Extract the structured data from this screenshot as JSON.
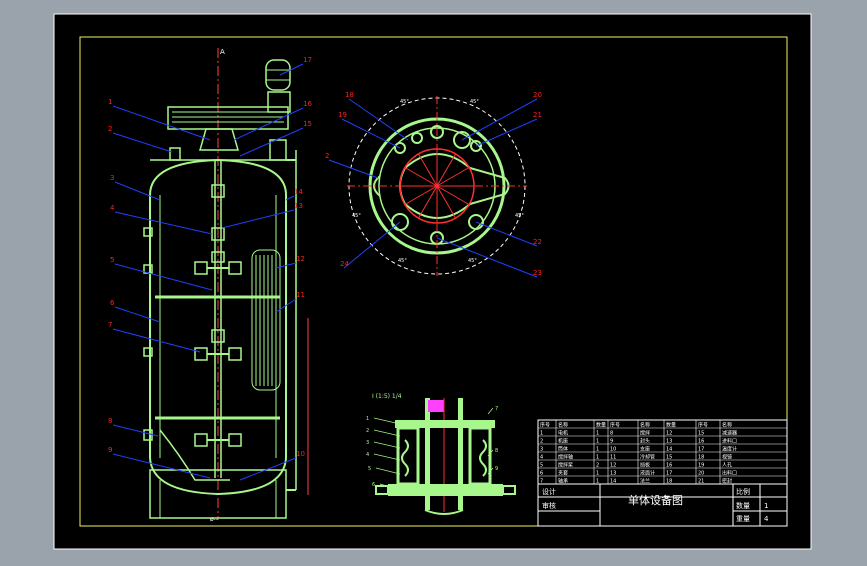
{
  "colors": {
    "canvas": "#9aa3ac",
    "paper": "#000000",
    "frame": "#f0f060",
    "border": "#ffffff",
    "equipment": "#a8f78c",
    "leader": "#2040ff",
    "callout": "#ff2020",
    "hatch": "#ff40ff",
    "shaft": "#ff3030"
  },
  "drawing": {
    "section_mark": "A",
    "base_dim": "ø--",
    "vessel_callouts": [
      "1",
      "2",
      "3",
      "4",
      "5",
      "6",
      "7",
      "8",
      "9",
      "10",
      "11",
      "12",
      "13",
      "14",
      "15",
      "16",
      "17"
    ],
    "plan_callouts": [
      "18",
      "19",
      "20",
      "21",
      "22",
      "23",
      "24",
      "2"
    ],
    "plan_angles": [
      "45°",
      "45°",
      "45°",
      "45°",
      "45°",
      "45°"
    ],
    "detail_title": "Ⅰ (1:5) 1/4",
    "detail_labels": [
      "1",
      "2",
      "3",
      "4",
      "5",
      "6",
      "7",
      "8",
      "9"
    ]
  },
  "title_block": {
    "drawing_title": "单体设备图",
    "material_label": "比例",
    "qty_label": "数量",
    "weight_label": "重量",
    "qty_value": "1",
    "weight_value": "4",
    "sign_rows": [
      "设计",
      "审核"
    ],
    "bom_header": [
      "序号",
      "名称",
      "数量",
      "序号",
      "名称",
      "数量",
      "序号",
      "名称"
    ],
    "bom_rows": [
      [
        "1",
        "电机",
        "1",
        "8",
        "搅拌",
        "12",
        "15",
        "减速器"
      ],
      [
        "2",
        "机座",
        "1",
        "9",
        "封头",
        "13",
        "16",
        "进料口"
      ],
      [
        "3",
        "筒体",
        "1",
        "10",
        "支座",
        "14",
        "17",
        "温度计"
      ],
      [
        "4",
        "搅拌轴",
        "1",
        "11",
        "冷却管",
        "15",
        "18",
        "视镜"
      ],
      [
        "5",
        "搅拌桨",
        "2",
        "12",
        "挡板",
        "16",
        "19",
        "人孔"
      ],
      [
        "6",
        "夹套",
        "1",
        "13",
        "液面计",
        "17",
        "20",
        "出料口"
      ],
      [
        "7",
        "轴承",
        "1",
        "14",
        "法兰",
        "18",
        "21",
        "密封"
      ]
    ]
  }
}
